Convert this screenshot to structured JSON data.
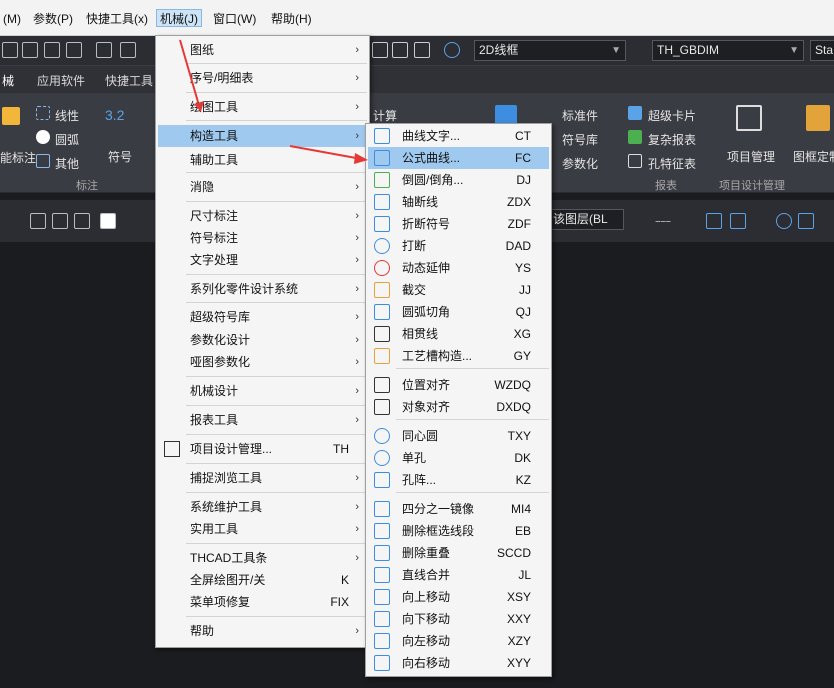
{
  "menubar": {
    "items": [
      "(M)",
      "参数(P)",
      "快捷工具(x)",
      "机械(J)",
      "窗口(W)",
      "帮助(H)"
    ]
  },
  "toolbar": {
    "view_style": "2D线框",
    "dim_style": "TH_GBDIM",
    "text_style": "Sta"
  },
  "tabs": [
    "械",
    "应用软件",
    "快捷工具"
  ],
  "ribbon": {
    "items": [
      "线性",
      "圆弧",
      "其他",
      "能标注",
      "符号",
      "标注",
      "计算",
      "标准件",
      "符号库",
      "参数化",
      "超级卡片",
      "复杂报表",
      "孔特征表",
      "报表",
      "项目管理",
      "项目设计管理",
      "图框定制"
    ],
    "num_label": "3.2"
  },
  "layer": {
    "label": "该图层(BL"
  },
  "main_menu": {
    "items": [
      {
        "label": "图纸",
        "sub": true
      },
      {
        "label": "序号/明细表",
        "sub": true
      },
      {
        "label": "绘图工具",
        "sub": true
      },
      {
        "label": "构造工具",
        "sub": true
      },
      {
        "label": "辅助工具",
        "sub": true
      },
      {
        "label": "消隐",
        "sub": true
      },
      {
        "label": "尺寸标注",
        "sub": true
      },
      {
        "label": "符号标注",
        "sub": true
      },
      {
        "label": "文字处理",
        "sub": true
      },
      {
        "label": "系列化零件设计系统",
        "sub": true
      },
      {
        "label": "超级符号库",
        "sub": true
      },
      {
        "label": "参数化设计",
        "sub": true
      },
      {
        "label": "哑图参数化",
        "sub": true
      },
      {
        "label": "机械设计",
        "sub": true
      },
      {
        "label": "报表工具",
        "sub": true
      },
      {
        "label": "项目设计管理...",
        "shortcut": "TH"
      },
      {
        "label": "捕捉浏览工具",
        "sub": true
      },
      {
        "label": "系统维护工具",
        "sub": true
      },
      {
        "label": "实用工具",
        "sub": true
      },
      {
        "label": "THCAD工具条",
        "sub": true
      },
      {
        "label": "全屏绘图开/关",
        "shortcut": "K"
      },
      {
        "label": "菜单项修复",
        "shortcut": "FIX"
      },
      {
        "label": "帮助",
        "sub": true
      }
    ]
  },
  "sub_menu": {
    "items": [
      {
        "label": "曲线文字...",
        "shortcut": "CT",
        "icon": "text-curve-icon"
      },
      {
        "label": "公式曲线...",
        "shortcut": "FC",
        "icon": "formula-curve-icon"
      },
      {
        "label": "倒圆/倒角...",
        "shortcut": "DJ",
        "icon": "fillet-icon"
      },
      {
        "label": "轴断线",
        "shortcut": "ZDX",
        "icon": "axis-break-icon"
      },
      {
        "label": "折断符号",
        "shortcut": "ZDF",
        "icon": "break-symbol-icon"
      },
      {
        "label": "打断",
        "shortcut": "DAD",
        "icon": "break-icon"
      },
      {
        "label": "动态延伸",
        "shortcut": "YS",
        "icon": "extend-icon"
      },
      {
        "label": "截交",
        "shortcut": "JJ",
        "icon": "intersect-icon"
      },
      {
        "label": "圆弧切角",
        "shortcut": "QJ",
        "icon": "arc-chamfer-icon"
      },
      {
        "label": "相贯线",
        "shortcut": "XG",
        "icon": "intersection-line-icon"
      },
      {
        "label": "工艺槽构造...",
        "shortcut": "GY",
        "icon": "groove-icon"
      },
      {
        "label": "位置对齐",
        "shortcut": "WZDQ",
        "icon": "align-position-icon"
      },
      {
        "label": "对象对齐",
        "shortcut": "DXDQ",
        "icon": "align-object-icon"
      },
      {
        "label": "同心圆",
        "shortcut": "TXY",
        "icon": "concentric-icon"
      },
      {
        "label": "单孔",
        "shortcut": "DK",
        "icon": "hole-icon"
      },
      {
        "label": "孔阵...",
        "shortcut": "KZ",
        "icon": "hole-array-icon"
      },
      {
        "label": "四分之一镜像",
        "shortcut": "MI4",
        "icon": "quarter-mirror-icon"
      },
      {
        "label": "删除框选线段",
        "shortcut": "EB",
        "icon": "delete-segment-icon"
      },
      {
        "label": "删除重叠",
        "shortcut": "SCCD",
        "icon": "delete-overlap-icon"
      },
      {
        "label": "直线合并",
        "shortcut": "JL",
        "icon": "merge-line-icon"
      },
      {
        "label": "向上移动",
        "shortcut": "XSY",
        "icon": "move-up-icon"
      },
      {
        "label": "向下移动",
        "shortcut": "XXY",
        "icon": "move-down-icon"
      },
      {
        "label": "向左移动",
        "shortcut": "XZY",
        "icon": "move-left-icon"
      },
      {
        "label": "向右移动",
        "shortcut": "XYY",
        "icon": "move-right-icon"
      }
    ]
  },
  "colors": {
    "highlight": "#9fc9ef",
    "accent": "#e53935",
    "ribbon_bg": "#3a3c43"
  }
}
